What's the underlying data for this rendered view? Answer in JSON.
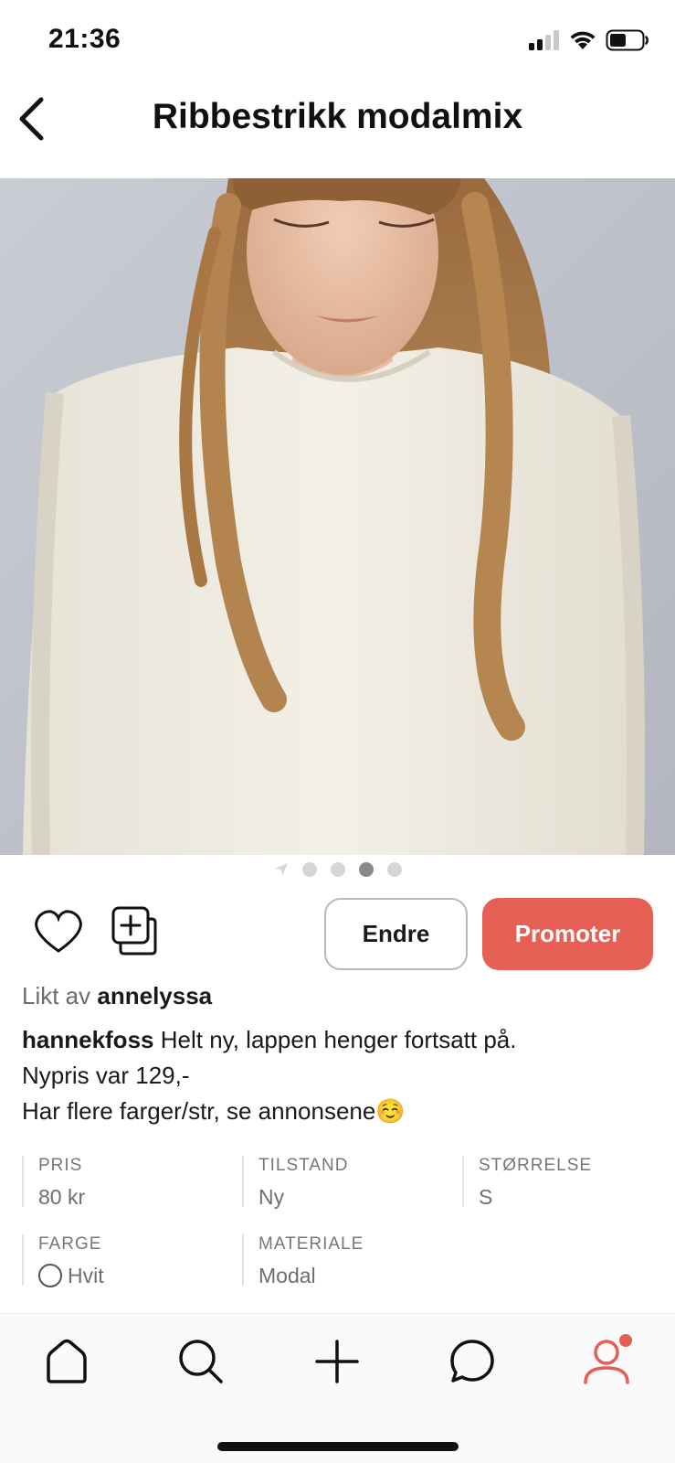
{
  "status_bar": {
    "time": "21:36",
    "icons": [
      "signal-icon",
      "wifi-icon",
      "battery-icon"
    ]
  },
  "header": {
    "title": "Ribbestrikk modalmix",
    "back_icon": "chevron-left-icon"
  },
  "photo": {
    "alt": "Product photo"
  },
  "pager": {
    "count": 4,
    "active_index": 2
  },
  "actions": {
    "edit_label": "Endre",
    "promote_label": "Promoter"
  },
  "likes": {
    "prefix": "Likt av",
    "user": "annelyssa"
  },
  "description": {
    "seller": "hannekfoss",
    "line1": "Helt ny, lappen henger fortsatt på.",
    "line2": "Nypris var 129,-",
    "line3": "Har flere farger/str, se annonsene☺️"
  },
  "details": {
    "price": {
      "label": "PRIS",
      "value": "80 kr"
    },
    "condition": {
      "label": "TILSTAND",
      "value": "Ny"
    },
    "size": {
      "label": "STØRRELSE",
      "value": "S"
    },
    "color": {
      "label": "FARGE",
      "value": "Hvit",
      "swatch": "#ffffff"
    },
    "material": {
      "label": "MATERIALE",
      "value": "Modal"
    }
  },
  "bottom_nav": {
    "items": [
      "home-icon",
      "search-icon",
      "plus-icon",
      "chat-icon",
      "profile-icon"
    ],
    "accent": "#e65f55"
  },
  "colors": {
    "accent": "#e65f55",
    "text": "#1a1a1a",
    "muted": "#6b6b6b"
  }
}
